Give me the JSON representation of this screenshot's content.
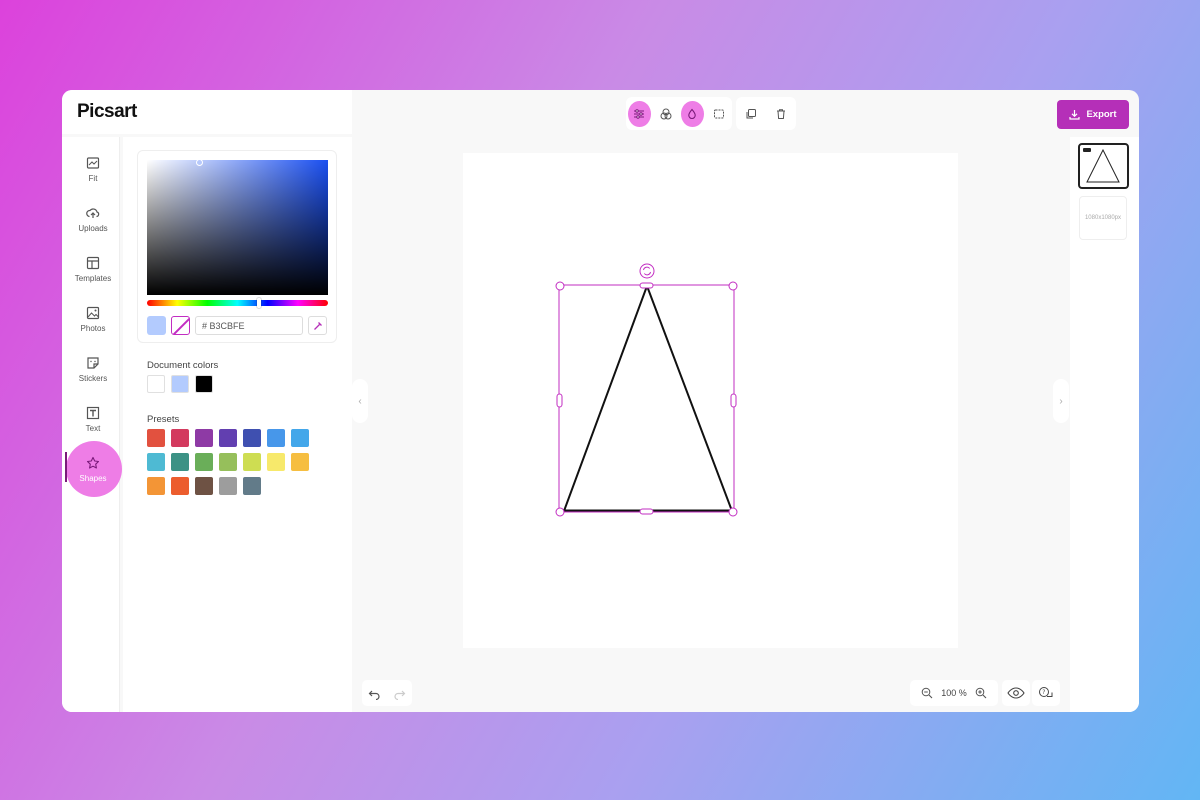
{
  "app": {
    "logo": "Picsart"
  },
  "sidebar": {
    "items": [
      {
        "label": "Fit",
        "icon": "fit-icon"
      },
      {
        "label": "Uploads",
        "icon": "upload-icon"
      },
      {
        "label": "Templates",
        "icon": "templates-icon"
      },
      {
        "label": "Photos",
        "icon": "photos-icon"
      },
      {
        "label": "Stickers",
        "icon": "stickers-icon"
      },
      {
        "label": "Text",
        "icon": "text-icon"
      },
      {
        "label": "Shapes",
        "icon": "star-icon",
        "active": true
      }
    ]
  },
  "color_panel": {
    "current_color": "#B3CBFE",
    "hex_value": "# B3CBFE",
    "document_colors_label": "Document colors",
    "document_colors": [
      "#FFFFFF",
      "#B3CBFE",
      "#000000"
    ],
    "presets_label": "Presets",
    "presets": [
      "#E2513F",
      "#D33A5E",
      "#8E3AA5",
      "#623FB0",
      "#3F50B0",
      "#4797EA",
      "#43A7EA",
      "#4EBAD3",
      "#3C9285",
      "#6AAE59",
      "#96BF5B",
      "#CEDD52",
      "#F7E96B",
      "#F6BE41",
      "#F39536",
      "#EC5D2E",
      "#6E5244",
      "#9D9D9D",
      "#627B89"
    ]
  },
  "toolbar": {
    "export_label": "Export"
  },
  "pages": {
    "size_label": "1080x1080px"
  },
  "zoom": {
    "value": "100 %"
  },
  "colors": {
    "accent": "#B52FB8",
    "highlight": "#EE7DE6",
    "selection": "#C22DC2"
  }
}
